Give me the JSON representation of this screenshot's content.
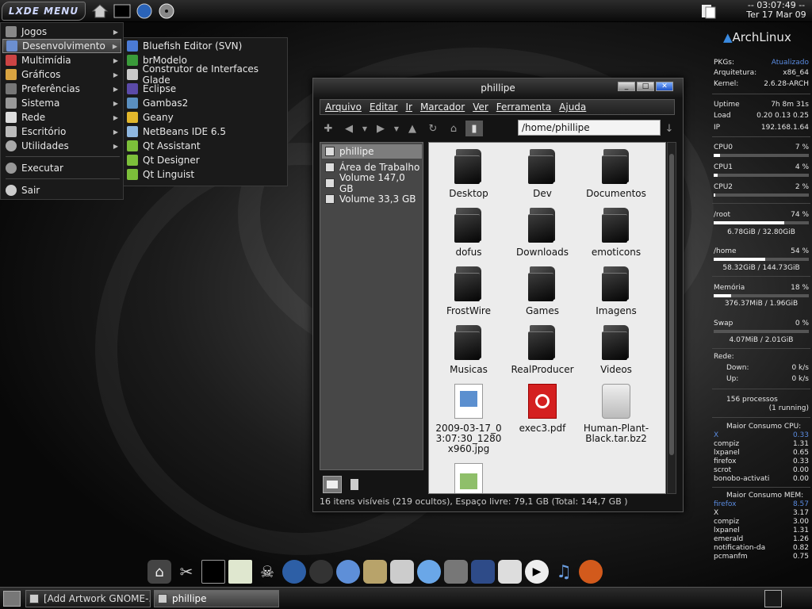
{
  "top_panel": {
    "menu_button": "LXDE MENU",
    "clock_time": "-- 03:07:49 --",
    "clock_date": "Ter 17 Mar 09"
  },
  "main_menu": {
    "items": [
      "Jogos",
      "Desenvolvimento",
      "Multimídia",
      "Gráficos",
      "Preferências",
      "Sistema",
      "Rede",
      "Escritório",
      "Utilidades"
    ],
    "run": "Executar",
    "exit": "Sair"
  },
  "sub_menu": {
    "items": [
      "Bluefish Editor (SVN)",
      "brModelo",
      "Construtor de Interfaces Glade",
      "Eclipse",
      "Gambas2",
      "Geany",
      "NetBeans IDE 6.5",
      "Qt Assistant",
      "Qt Designer",
      "Qt Linguist"
    ]
  },
  "window": {
    "title": "phillipe",
    "menubar": [
      "Arquivo",
      "Editar",
      "Ir",
      "Marcador",
      "Ver",
      "Ferramenta",
      "Ajuda"
    ],
    "path": "/home/phillipe",
    "places": [
      "phillipe",
      "Área de Trabalho",
      "Volume 147,0 GB",
      "Volume 33,3 GB"
    ],
    "files": [
      "Desktop",
      "Dev",
      "Documentos",
      "dofus",
      "Downloads",
      "emoticons",
      "FrostWire",
      "Games",
      "Imagens",
      "Musicas",
      "RealProducer",
      "Videos",
      "2009-03-17_03:07:30_1280x960.jpg",
      "exec3.pdf",
      "Human-Plant-Black.tar.bz2"
    ],
    "status": "16 itens visíveis  (219 ocultos), Espaço livre: 79,1 GB (Total: 144,7 GB )"
  },
  "conky": {
    "distro": "ArchLinux",
    "pkgs_label": "PKGs:",
    "pkgs_value": "Atualizado",
    "arch_label": "Arquitetura:",
    "arch_value": "x86_64",
    "kernel_label": "Kernel:",
    "kernel_value": "2.6.28-ARCH",
    "uptime_label": "Uptime",
    "uptime_value": "7h 8m 31s",
    "load_label": "Load",
    "load_value": "0.20 0.13 0.25",
    "ip_label": "IP",
    "ip_value": "192.168.1.64",
    "cpu0_label": "CPU0",
    "cpu0_value": "7 %",
    "cpu0_pct": 7,
    "cpu1_label": "CPU1",
    "cpu1_value": "4 %",
    "cpu1_pct": 4,
    "cpu2_label": "CPU2",
    "cpu2_value": "2 %",
    "cpu2_pct": 2,
    "root_label": "/root",
    "root_value": "74 %",
    "root_pct": 74,
    "root_usage": "6.78GiB  / 32.80GiB",
    "home_label": "/home",
    "home_value": "54 %",
    "home_pct": 54,
    "home_usage": "58.32GiB  / 144.73GiB",
    "mem_label": "Memória",
    "mem_value": "18 %",
    "mem_pct": 18,
    "mem_usage": "376.37MiB / 1.96GiB",
    "swap_label": "Swap",
    "swap_value": "0 %",
    "swap_pct": 0,
    "swap_usage": "4.07MiB  / 2.01GiB",
    "net_label": "Rede:",
    "down_label": "Down:",
    "down_value": "0 k/s",
    "up_label": "Up:",
    "up_value": "0 k/s",
    "processes": "156  processos",
    "running": "(1  running)",
    "cpu_top_label": "Maior Consumo CPU:",
    "cpu_top": [
      [
        "X",
        "0.33"
      ],
      [
        "compiz",
        "1.31"
      ],
      [
        "lxpanel",
        "0.65"
      ],
      [
        "firefox",
        "0.33"
      ],
      [
        "scrot",
        "0.00"
      ],
      [
        "bonobo-activati",
        "0.00"
      ]
    ],
    "mem_top_label": "Maior Consumo MEM:",
    "mem_top": [
      [
        "firefox",
        "8.57"
      ],
      [
        "X",
        "3.17"
      ],
      [
        "compiz",
        "3.00"
      ],
      [
        "lxpanel",
        "1.31"
      ],
      [
        "emerald",
        "1.26"
      ],
      [
        "notification-da",
        "0.82"
      ],
      [
        "pcmanfm",
        "0.75"
      ]
    ]
  },
  "taskbar": {
    "tasks": [
      "[Add Artwork GNOME-...",
      "phillipe"
    ]
  }
}
